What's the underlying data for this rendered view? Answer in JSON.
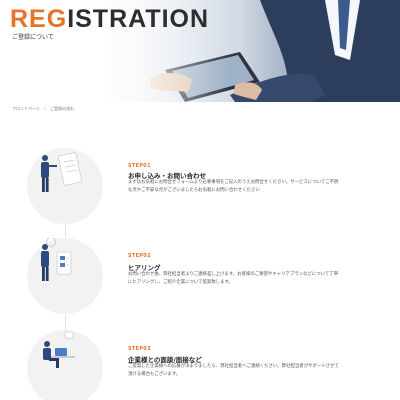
{
  "hero": {
    "title_accent": "REG",
    "title_rest": "ISTRATION",
    "subtitle": "ご登録について"
  },
  "breadcrumb": {
    "items": [
      "フロントページ",
      "›",
      "ご登録の流れ"
    ]
  },
  "steps": [
    {
      "number": "STEP01",
      "title": "お申し込み・お問い合わせ",
      "description": "まずはお気軽にお問合せフォームより必要事項をご記入のうえお問合せください。サービスについてご不明な点やご不安な点がございましたらお気軽にお問い合わせください"
    },
    {
      "number": "STEP02",
      "title": "ヒアリング",
      "description": "お問い合わせ後、弊社担当者よりご連絡差し上げます。お客様のご要望やキャリアプランなどについて丁寧にヒアリングし、ご紹介企業について提案致します。"
    },
    {
      "number": "STEP03",
      "title": "企業様との面談/面接など",
      "description": "ご提案した企業様への応募が決まりましたら、弊社担当者へご連絡ください。弊社担当者がサポートさせて頂ける場合もございます。"
    }
  ],
  "colors": {
    "accent": "#e8742b",
    "text": "#333333",
    "circle": "#f2f2f2"
  }
}
